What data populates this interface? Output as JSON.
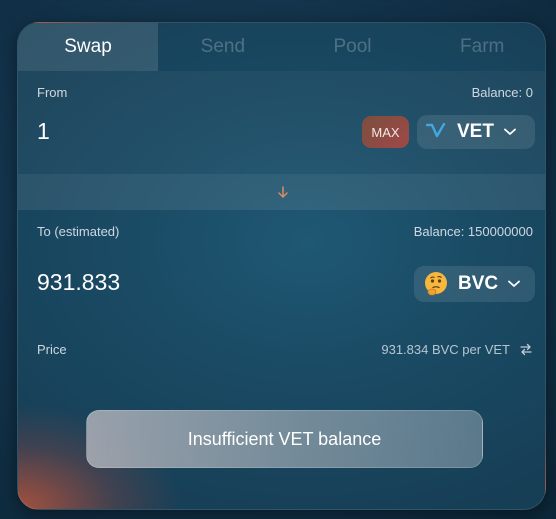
{
  "tabs": [
    {
      "label": "Swap",
      "active": true
    },
    {
      "label": "Send",
      "active": false
    },
    {
      "label": "Pool",
      "active": false
    },
    {
      "label": "Farm",
      "active": false
    }
  ],
  "from": {
    "label": "From",
    "balance": "Balance: 0",
    "amount": "1",
    "max_label": "MAX",
    "token": {
      "symbol": "VET",
      "icon": "vechain-logo-icon"
    }
  },
  "switch_icon": "arrow-down-icon",
  "to": {
    "label": "To (estimated)",
    "balance": "Balance: 150000000",
    "amount": "931.833",
    "token": {
      "symbol": "BVC",
      "icon": "thinking-face-emoji-icon"
    }
  },
  "price": {
    "label": "Price",
    "value": "931.834 BVC per VET",
    "icon": "swap-rates-icon"
  },
  "action_button": "Insufficient VET balance",
  "colors": {
    "accent_max": "#a04848",
    "vet_logo": "#3fa9e0",
    "arrow": "#d98b6a"
  }
}
